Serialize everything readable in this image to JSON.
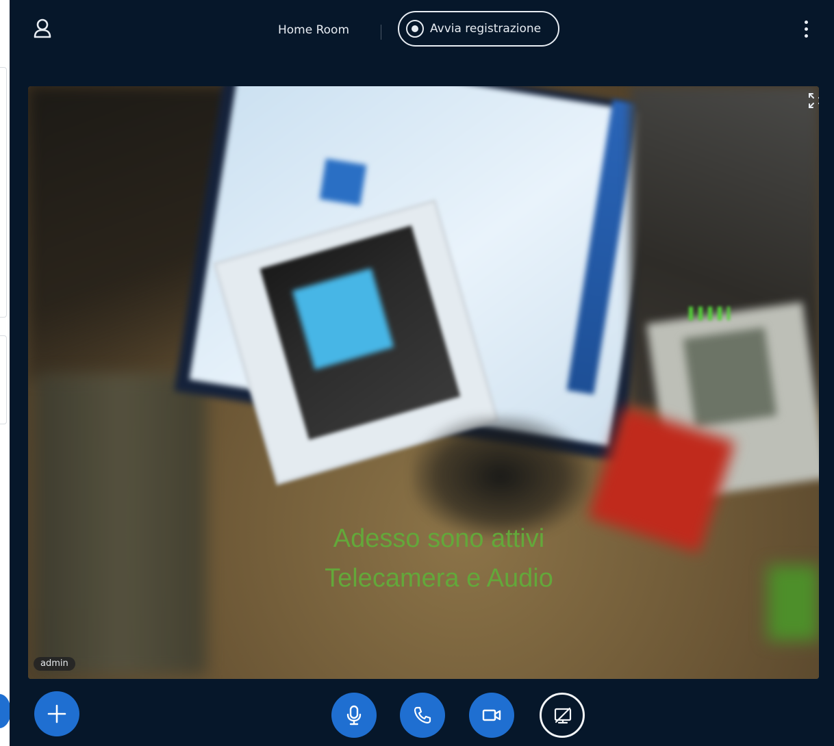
{
  "header": {
    "room_title": "Home Room",
    "record_label": "Avvia registrazione"
  },
  "video": {
    "participant_name": "admin",
    "overlay_line1": "Adesso sono attivi",
    "overlay_line2": "Telecamera e Audio"
  },
  "icons": {
    "user": "user-icon",
    "record": "record-icon",
    "menu": "kebab-menu-icon",
    "fullscreen": "fullscreen-icon",
    "add": "plus-icon",
    "microphone": "microphone-icon",
    "phone": "phone-icon",
    "camera": "video-camera-icon",
    "screenshare": "screenshare-off-icon"
  },
  "colors": {
    "app_background": "#06172a",
    "accent_blue": "#1f6fd1",
    "overlay_text": "#63a83a",
    "foreground": "#e8edf3"
  }
}
